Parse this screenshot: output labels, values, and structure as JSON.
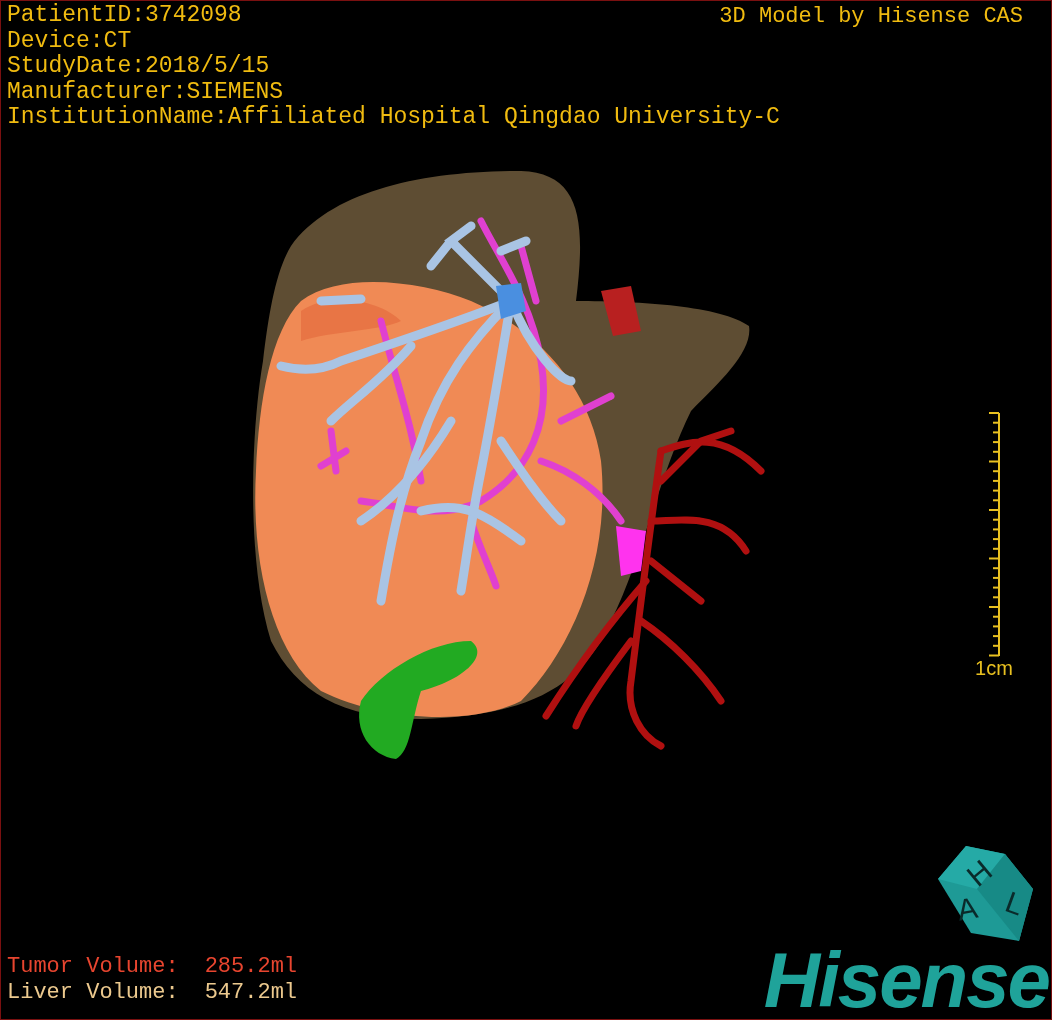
{
  "patient_info": [
    "PatientID:3742098",
    "Device:CT",
    "StudyDate:2018/5/15",
    "Manufacturer:SIEMENS",
    "InstitutionName:Affiliated Hospital Qingdao University-C"
  ],
  "header_right": "3D Model by Hisense CAS",
  "scale_bar": {
    "label": "1cm"
  },
  "orientation_cube": {
    "faces": [
      "H",
      "A",
      "L"
    ]
  },
  "volumes": [
    {
      "kind": "tumor",
      "label": "Tumor Volume:",
      "value": "285.2ml"
    },
    {
      "kind": "liver",
      "label": "Liver Volume:",
      "value": "547.2ml"
    }
  ],
  "logo": "Hisense"
}
